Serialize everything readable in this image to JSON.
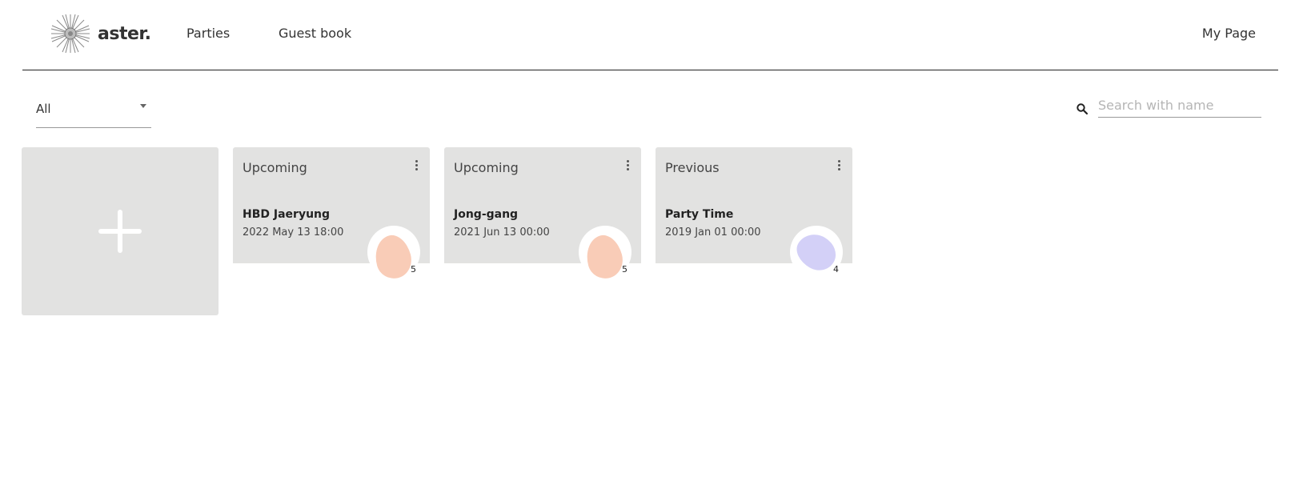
{
  "header": {
    "logo_text": "aster.",
    "nav": {
      "parties": "Parties",
      "guest_book": "Guest book",
      "my_page": "My Page"
    }
  },
  "filter": {
    "selected": "All"
  },
  "search": {
    "placeholder": "Search with name",
    "value": ""
  },
  "parties": [
    {
      "status": "Upcoming",
      "name": "HBD Jaeryung",
      "date": "2022 May 13 18:00",
      "guest_count": "5",
      "blob_color": "#f9ccb7"
    },
    {
      "status": "Upcoming",
      "name": "Jong-gang",
      "date": "2021 Jun 13 00:00",
      "guest_count": "5",
      "blob_color": "#f9ccb7"
    },
    {
      "status": "Previous",
      "name": "Party Time",
      "date": "2019 Jan 01 00:00",
      "guest_count": "4",
      "blob_color": "#d3d0f7"
    }
  ],
  "colors": {
    "card_background": "#e2e2e1",
    "text": "#333333"
  }
}
